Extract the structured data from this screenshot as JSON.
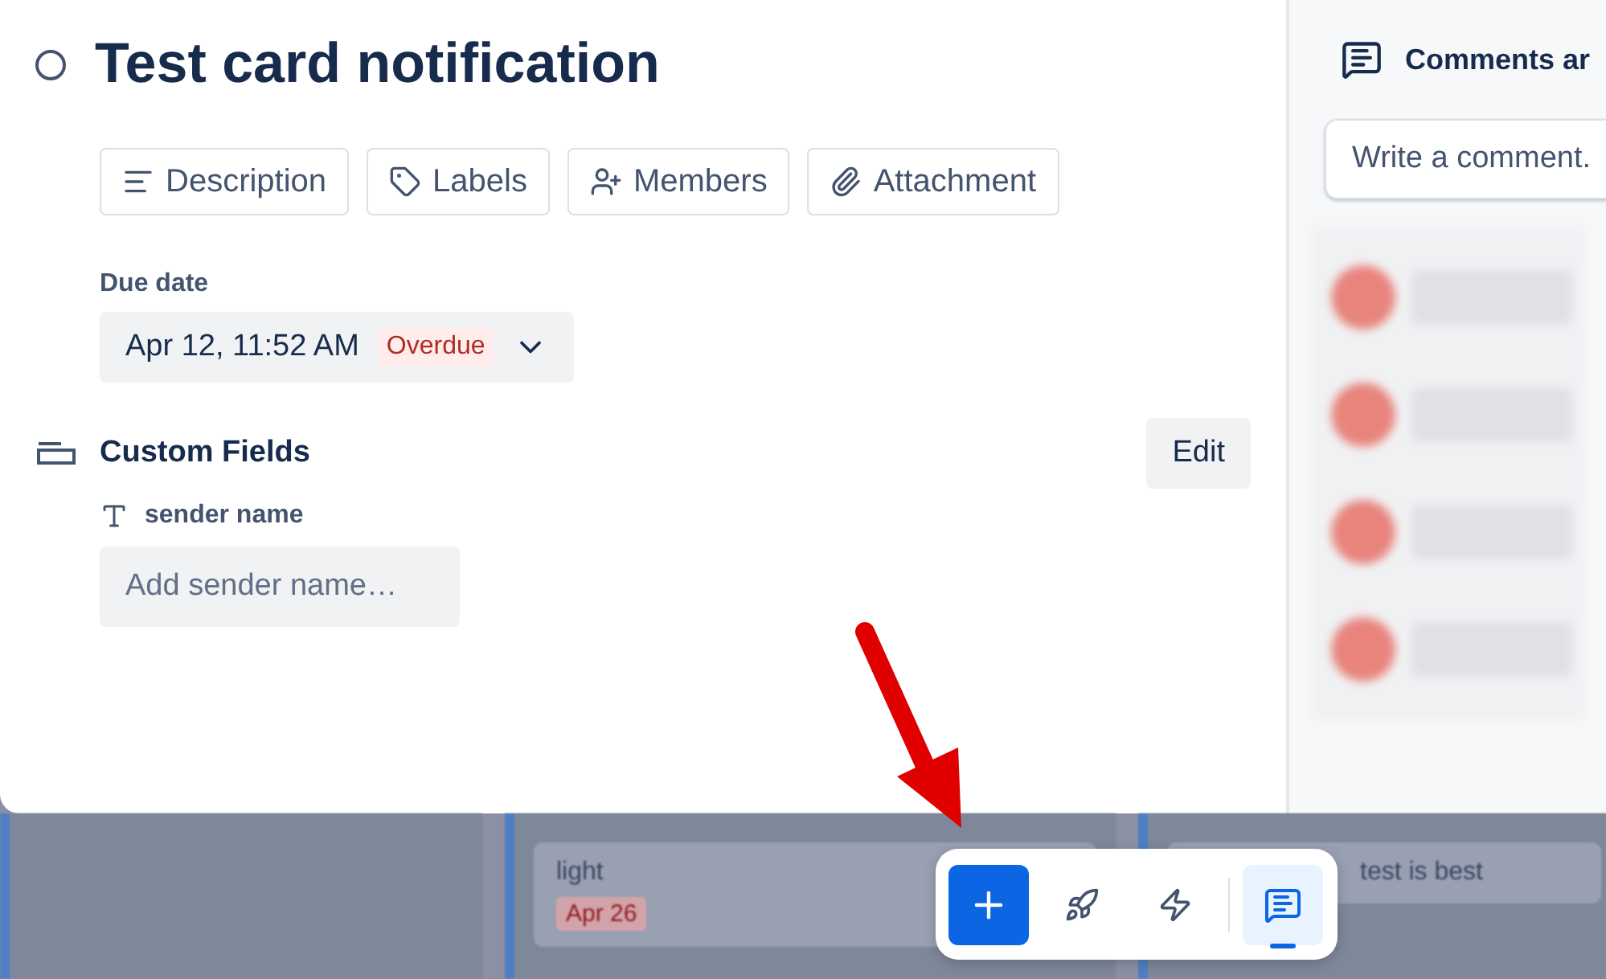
{
  "card": {
    "title": "Test card notification",
    "completed": false,
    "actions": [
      {
        "label": "Description",
        "kind": "description"
      },
      {
        "label": "Labels",
        "kind": "labels"
      },
      {
        "label": "Members",
        "kind": "members"
      },
      {
        "label": "Attachment",
        "kind": "attachment"
      }
    ],
    "due_date": {
      "label": "Due date",
      "value": "Apr 12, 11:52 AM",
      "status": "Overdue"
    },
    "custom_fields": {
      "title": "Custom Fields",
      "edit_button": "Edit",
      "fields": [
        {
          "label": "sender name",
          "placeholder": "Add sender name…"
        }
      ]
    }
  },
  "comments_panel": {
    "title": "Comments ar",
    "placeholder": "Write a comment."
  },
  "board": {
    "cards": [
      {
        "title": "light",
        "due": "Apr 26"
      },
      {
        "title": "test is best"
      }
    ]
  },
  "toolbar": [
    {
      "kind": "add"
    },
    {
      "kind": "rocket",
      "selected": false
    },
    {
      "kind": "lightning",
      "selected": false
    },
    {
      "kind": "comments",
      "selected": true
    }
  ]
}
